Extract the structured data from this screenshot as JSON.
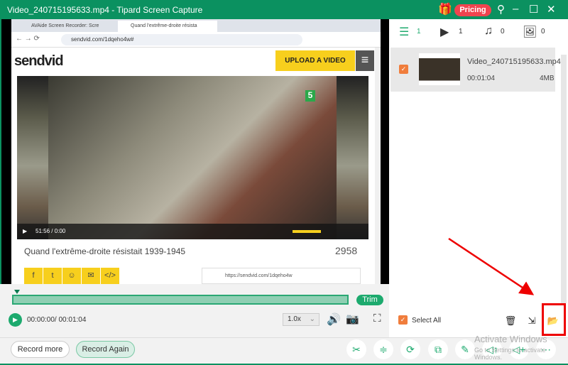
{
  "window": {
    "title": "Video_240715195633.mp4  -  Tipard Screen Capture",
    "pricing": "Pricing"
  },
  "browser": {
    "tabs": [
      "AVAide Screen Recorder: Scre",
      "Quand l'extrême-droite résista"
    ],
    "url": "sendvid.com/1dqeho4w#",
    "logo": "sendvid",
    "upload": "UPLOAD A VIDEO",
    "video_time": "51:56  /  0:00",
    "video_title": "Quand l'extrême-droite résistait 1939-1945",
    "views": "2958",
    "share_link": "https://sendvid.com/1dqeho4w",
    "channel_badge": "5"
  },
  "player": {
    "trim": "Trim",
    "time": "00:00:00/ 00:01:04",
    "speed": "1.0x"
  },
  "buttons": {
    "record_more": "Record more",
    "record_again": "Record Again"
  },
  "tools": [
    "scissors-icon",
    "compress-icon",
    "convert-icon",
    "merge-icon",
    "edit-icon",
    "audio-boost-icon",
    "audio-add-icon",
    "more-icon"
  ],
  "library": {
    "counts": {
      "all": "1",
      "video": "1",
      "audio": "0",
      "image": "0"
    },
    "items": [
      {
        "name": "Video_240715195633.mp4",
        "duration": "00:01:04",
        "size": "4MB",
        "checked": true
      }
    ],
    "select_all": "Select All"
  },
  "watermark": {
    "line1": "Activate Windows",
    "line2": "Go to Settings to activate Windows."
  },
  "colors": {
    "accent": "#1daa6e",
    "titlebar": "#0b9160",
    "highlight": "#e00000",
    "checkbox": "#f07d3c"
  }
}
